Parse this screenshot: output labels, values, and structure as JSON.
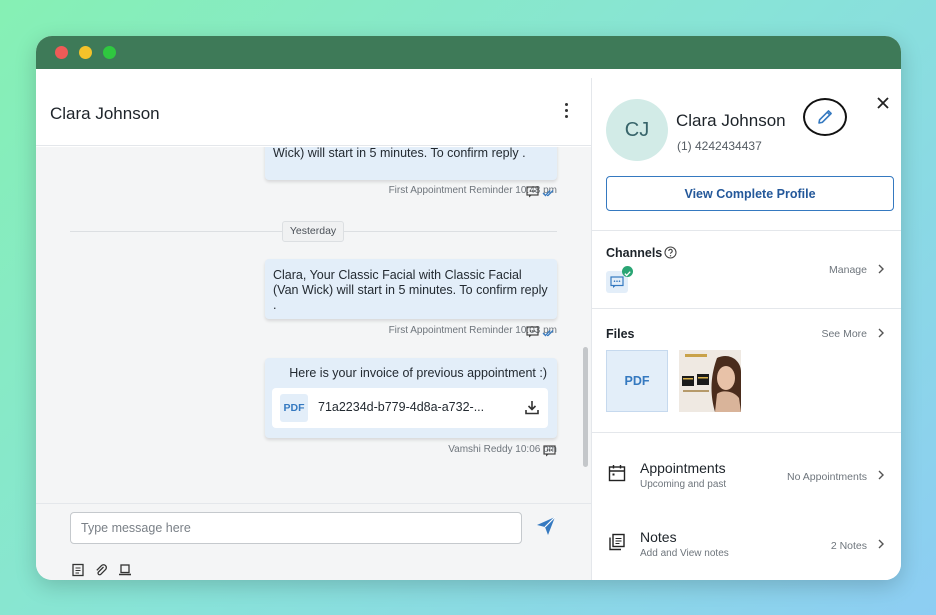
{
  "chat": {
    "title": "Clara Johnson",
    "messages": [
      {
        "text": "Wick) will start in 5 minutes. To confirm reply .",
        "meta": "First Appointment Reminder 10:48 pm"
      },
      {
        "text": "Clara, Your Classic Facial with Classic Facial (Van Wick) will start in 5 minutes. To confirm reply .",
        "meta": "First Appointment Reminder 10:03 pm"
      },
      {
        "text": "Here is your invoice of previous appointment :)",
        "attachment_badge": "PDF",
        "attachment_name": "71a2234d-b779-4d8a-a732-...",
        "meta": "Vamshi Reddy 10:06 pm"
      }
    ],
    "date_divider": "Yesterday",
    "composer_placeholder": "Type message here"
  },
  "profile": {
    "initials": "CJ",
    "name": "Clara Johnson",
    "phone": "(1) 4242434437",
    "view_button": "View Complete Profile"
  },
  "channels": {
    "title": "Channels",
    "action": "Manage"
  },
  "files": {
    "title": "Files",
    "action": "See More",
    "pdf_label": "PDF"
  },
  "appointments": {
    "title": "Appointments",
    "subtitle": "Upcoming and past",
    "status": "No Appointments"
  },
  "notes": {
    "title": "Notes",
    "subtitle": "Add and View notes",
    "status": "2 Notes"
  },
  "colors": {
    "accent": "#3579c0",
    "bubble": "#e3eef9",
    "titlebar": "#3e7a58",
    "online": "#2aa574"
  }
}
